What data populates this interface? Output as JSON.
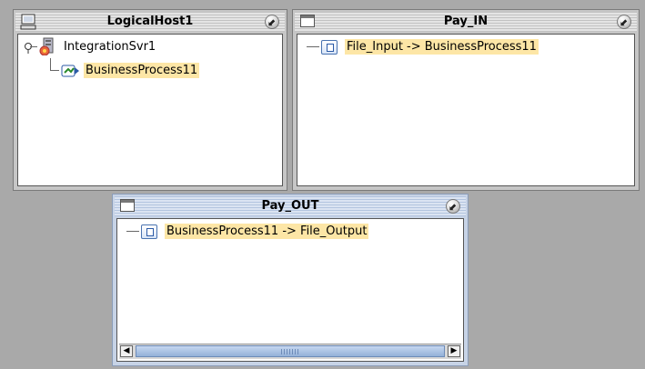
{
  "panels": {
    "logical_host": {
      "title": "LogicalHost1",
      "server_label": "IntegrationSvr1",
      "process_label": "BusinessProcess11"
    },
    "pay_in": {
      "title": "Pay_IN",
      "connection_label": "File_Input -> BusinessProcess11"
    },
    "pay_out": {
      "title": "Pay_OUT",
      "connection_label": "BusinessProcess11 -> File_Output"
    }
  },
  "controls": {
    "restore_glyph": "⬋",
    "scroll_left_glyph": "◀",
    "scroll_right_glyph": "▶"
  },
  "colors": {
    "selection": "#fde6a6",
    "active_panel": "#c7d3e6",
    "canvas_background": "#a9a9a9"
  },
  "icons": {
    "logical_host": "computer-icon",
    "window": "window-icon",
    "restore": "restore-icon",
    "server": "integration-server-icon",
    "process": "business-process-icon",
    "connection": "file-document-icon"
  }
}
